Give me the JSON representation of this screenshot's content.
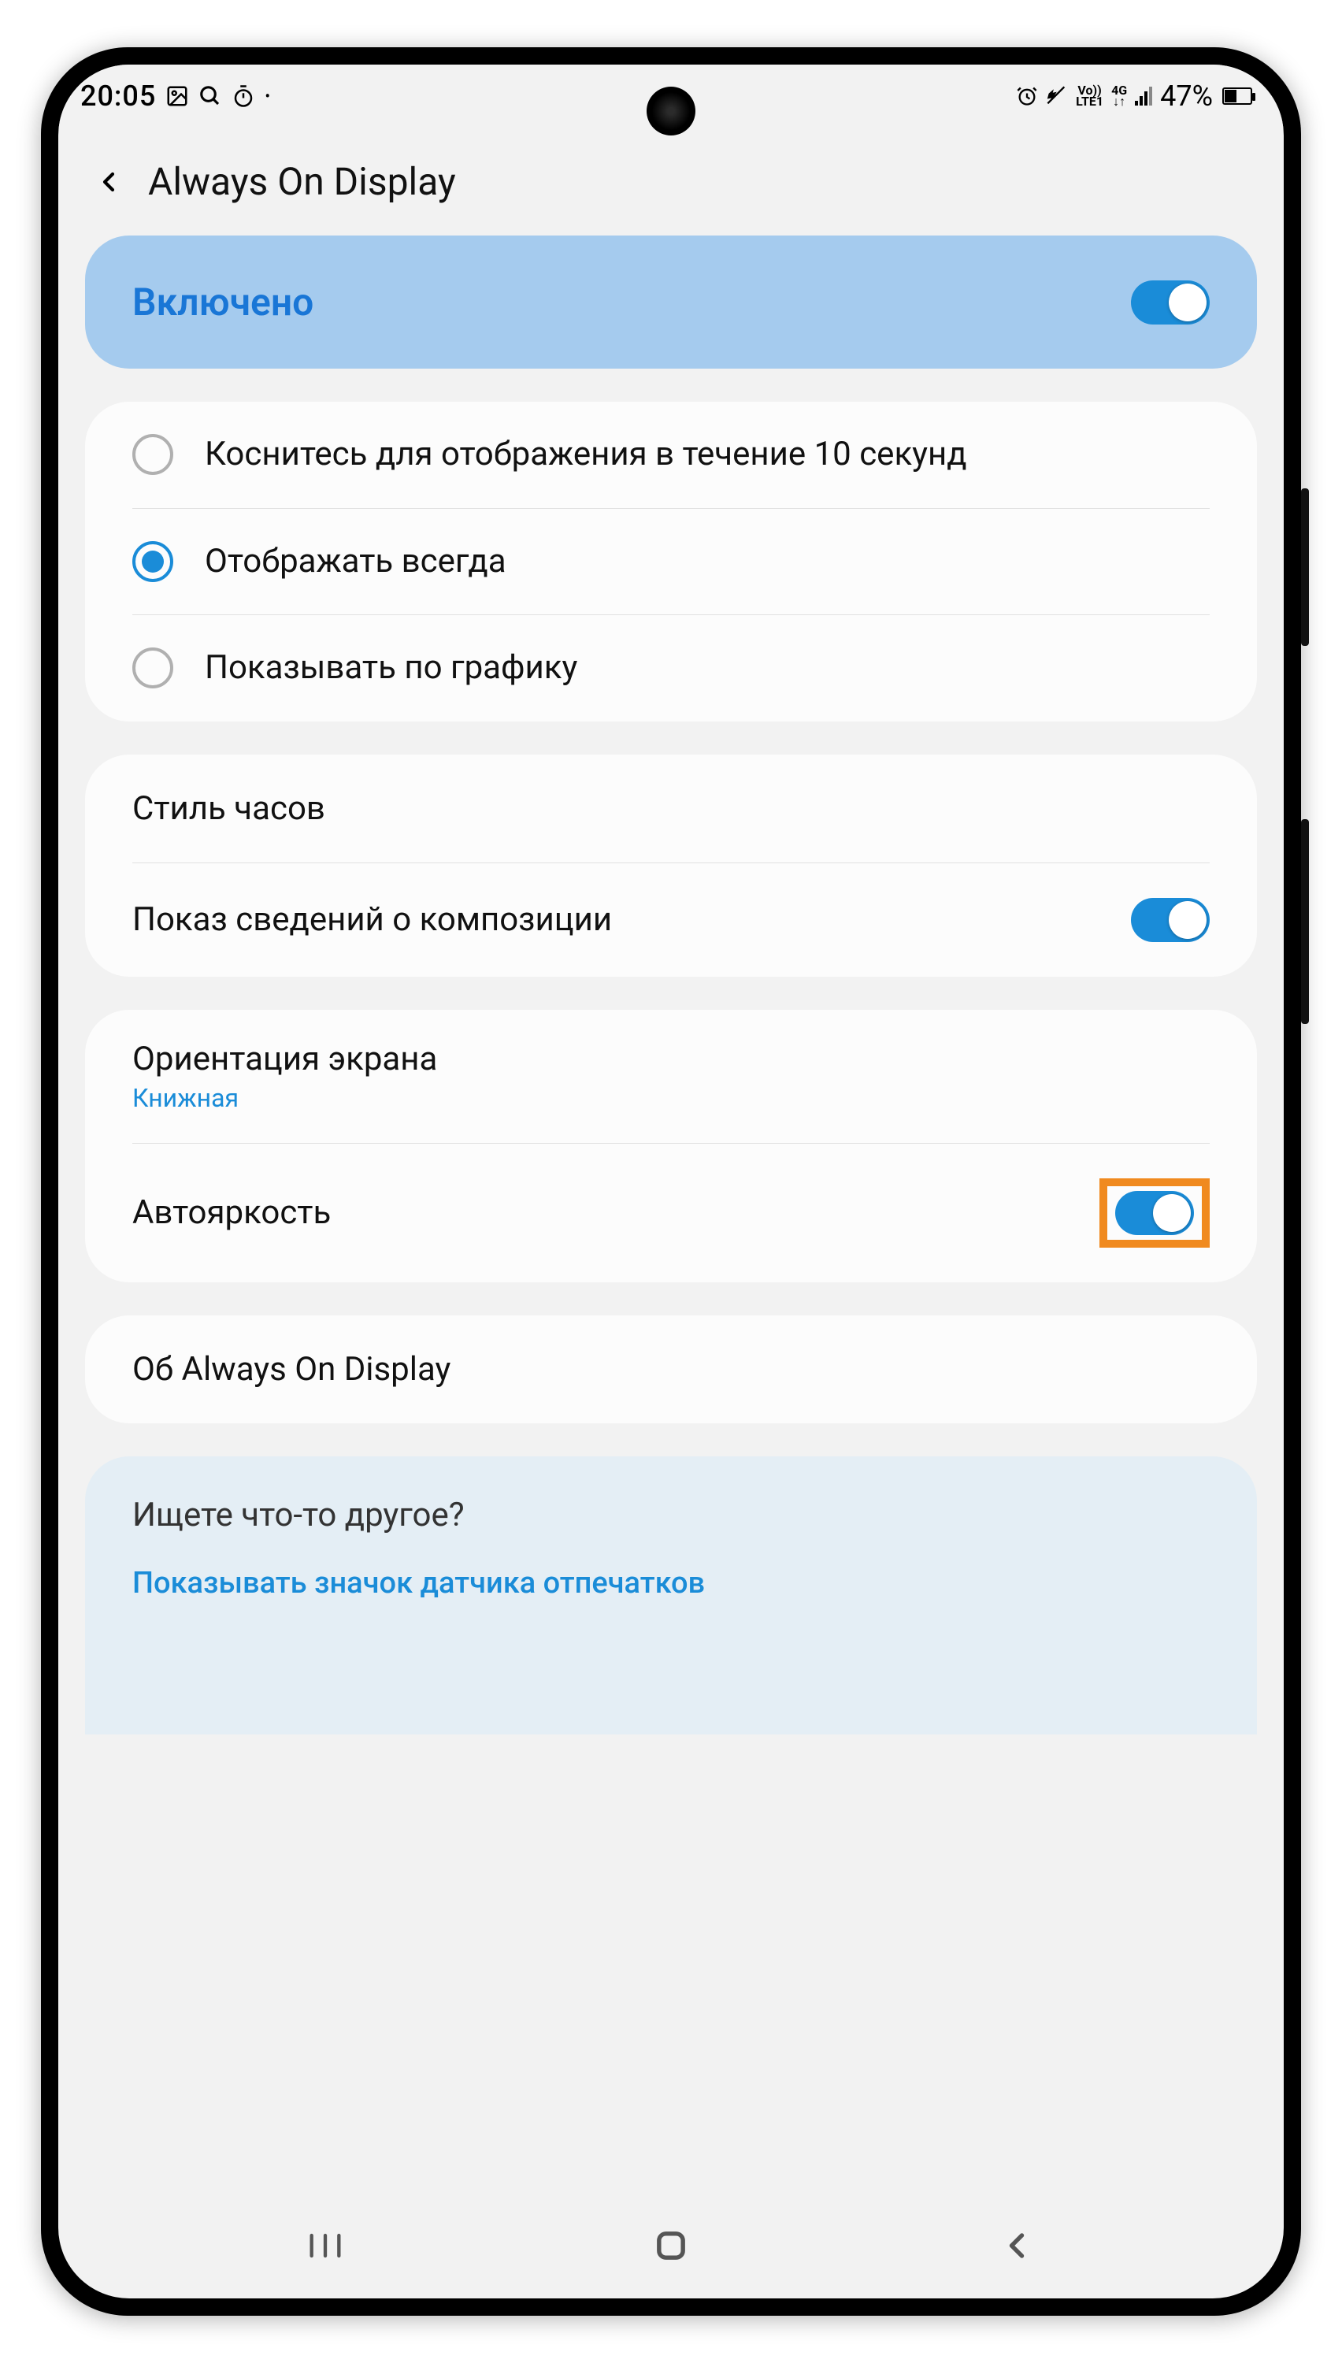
{
  "statusBar": {
    "time": "20:05",
    "batteryText": "47%"
  },
  "header": {
    "title": "Always On Display"
  },
  "enabled": {
    "label": "Включено",
    "on": true
  },
  "radioOptions": [
    {
      "label": "Коснитесь для отображения в течение 10 секунд",
      "selected": false
    },
    {
      "label": "Отображать всегда",
      "selected": true
    },
    {
      "label": "Показывать по графику",
      "selected": false
    }
  ],
  "settings1": {
    "clockStyle": "Стиль часов",
    "musicInfo": {
      "label": "Показ сведений о композиции",
      "on": true
    }
  },
  "settings2": {
    "orientation": {
      "label": "Ориентация экрана",
      "value": "Книжная"
    },
    "autoBrightness": {
      "label": "Автояркость",
      "on": true
    }
  },
  "about": {
    "label": "Об Always On Display"
  },
  "help": {
    "title": "Ищете что-то другое?",
    "link": "Показывать значок датчика отпечатков"
  }
}
